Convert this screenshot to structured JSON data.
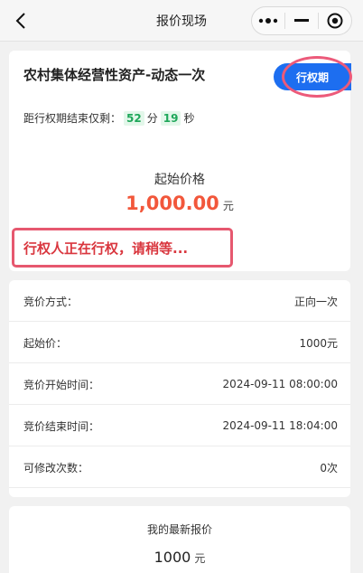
{
  "nav": {
    "title": "报价现场",
    "back_icon": "chevron-left-icon",
    "more_icon": "more-dots-icon",
    "minimize_icon": "minus-icon",
    "close_icon": "target-circle-icon"
  },
  "asset": {
    "title": "农村集体经营性资产-动态一次",
    "exercise_button": "行权期",
    "countdown": {
      "prefix": "距行权期结束仅剩：",
      "minutes": "52",
      "minutes_unit": "分",
      "seconds": "19",
      "seconds_unit": "秒"
    },
    "start_price_label": "起始价格",
    "start_price_value": "1,000.00",
    "start_price_unit": "元",
    "status_message": "行权人正在行权，请稍等..."
  },
  "details": {
    "rows": [
      {
        "label": "竞价方式：",
        "value": "正向一次"
      },
      {
        "label": "起始价：",
        "value": "1000元"
      },
      {
        "label": "竞价开始时间：",
        "value": "2024-09-11 08:00:00"
      },
      {
        "label": "竞价结束时间：",
        "value": "2024-09-11 18:04:00"
      },
      {
        "label": "可修改次数：",
        "value": "0次"
      }
    ]
  },
  "my_bid": {
    "label": "我的最新报价",
    "value": "1000",
    "unit": "元"
  },
  "colors": {
    "accent_blue": "#1d6ef0",
    "price_red": "#f2573b",
    "countdown_green": "#1fa75a",
    "highlight_pink": "#e6586f"
  }
}
